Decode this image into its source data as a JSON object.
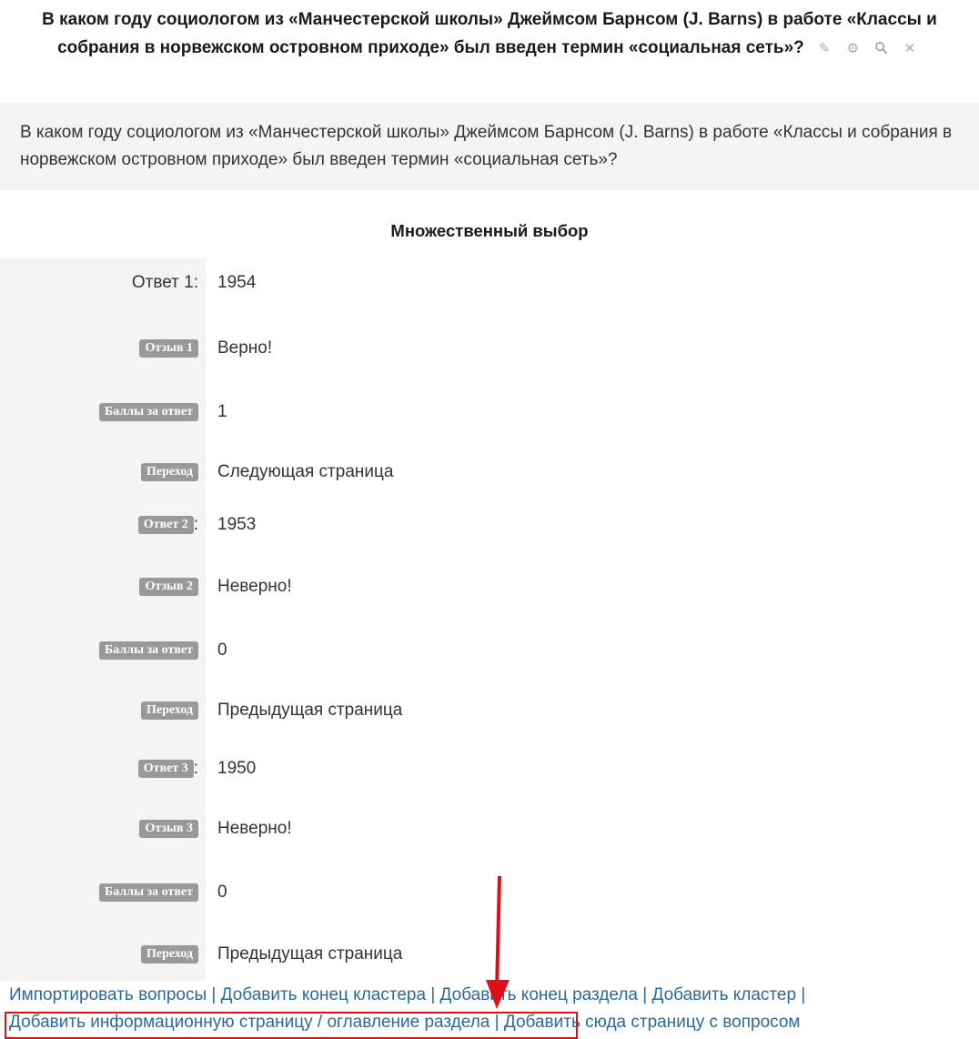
{
  "title": "В каком году социологом из «Манчестерской школы» Джеймсом Барнсом (J. Barns) в работе «Классы и собрания в норвежском островном приходе» был введен термин «социальная сеть»?",
  "title_icons": [
    {
      "name": "edit-icon",
      "glyph": "✎"
    },
    {
      "name": "gear-icon",
      "glyph": "⚙"
    },
    {
      "name": "search-icon",
      "glyph": "🔍"
    },
    {
      "name": "close-icon",
      "glyph": "✕"
    }
  ],
  "contents": "В каком году социологом из «Манчестерской школы» Джеймсом Барнсом (J. Barns) в работе «Классы и собрания в норвежском островном приходе» был введен термин «социальная сеть»?",
  "section_header": "Множественный выбор",
  "rows": [
    {
      "label": "Ответ 1:",
      "badge": false,
      "value": "1954"
    },
    {
      "label": "Отзыв 1",
      "badge": true,
      "value": "Верно!"
    },
    {
      "label": "Баллы за ответ",
      "badge": true,
      "value": "1"
    },
    {
      "label": "Переход",
      "badge": true,
      "value": "Следующая страница"
    },
    {
      "label": "Ответ 2",
      "badge": true,
      "suffix": ":",
      "value": "1953"
    },
    {
      "label": "Отзыв 2",
      "badge": true,
      "value": "Неверно!"
    },
    {
      "label": "Баллы за ответ",
      "badge": true,
      "value": "0"
    },
    {
      "label": "Переход",
      "badge": true,
      "value": "Предыдущая страница"
    },
    {
      "label": "Ответ 3",
      "badge": true,
      "suffix": ":",
      "value": "1950"
    },
    {
      "label": "Отзыв 3",
      "badge": true,
      "value": "Неверно!"
    },
    {
      "label": "Баллы за ответ",
      "badge": true,
      "value": "0"
    },
    {
      "label": "Переход",
      "badge": true,
      "value": "Предыдущая страница"
    }
  ],
  "links": [
    "Импортировать вопросы",
    "Добавить конец кластера",
    "Добавить конец раздела",
    "Добавить кластер",
    "Добавить информационную страницу / оглавление раздела",
    "Добавить сюда страницу с вопросом"
  ],
  "separator": "|",
  "annotation_color": "#e0101a"
}
